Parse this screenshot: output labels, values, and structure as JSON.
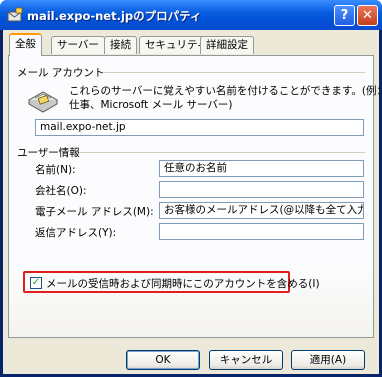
{
  "window": {
    "title": "mail.expo-net.jpのプロパティ",
    "help_label": "?",
    "close_label": "✕"
  },
  "tabs": [
    {
      "label": "全般",
      "active": true
    },
    {
      "label": "サーバー",
      "active": false
    },
    {
      "label": "接続",
      "active": false
    },
    {
      "label": "セキュリティ",
      "active": false
    },
    {
      "label": "詳細設定",
      "active": false
    }
  ],
  "mail_account": {
    "group_title": "メール アカウント",
    "description_line1": "これらのサーバーに覚えやすい名前を付けることができます。(例：",
    "description_line2": "仕事、Microsoft メール サーバー)",
    "account_name": "mail.expo-net.jp"
  },
  "user_info": {
    "group_title": "ユーザー情報",
    "name_label": "名前(N):",
    "name_value": "任意のお名前",
    "company_label": "会社名(O):",
    "company_value": "",
    "email_label": "電子メール アドレス(M):",
    "email_value": "お客様のメールアドレス(@以降も全て入力)",
    "reply_label": "返信アドレス(Y):",
    "reply_value": ""
  },
  "include_checkbox": {
    "checked": true,
    "label": "メールの受信時および同期時にこのアカウントを含める(I)"
  },
  "buttons": {
    "ok": "OK",
    "cancel": "キャンセル",
    "apply": "適用(A)"
  }
}
